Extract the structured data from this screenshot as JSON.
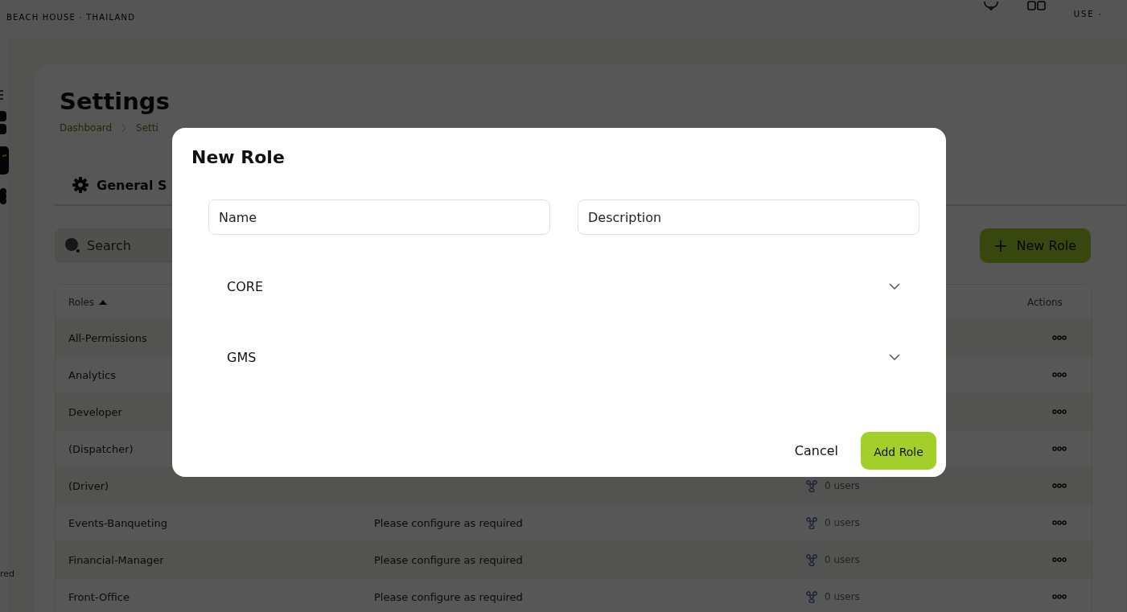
{
  "header": {
    "brand_tagline": "BEACH HOUSE · THAILAND",
    "user_label": "USE ·"
  },
  "sidebar": {
    "footer_text": "red"
  },
  "page": {
    "title": "Settings",
    "breadcrumb": [
      "Dashboard",
      "Setti"
    ],
    "tabs": [
      {
        "label": "General S",
        "selected": true
      }
    ],
    "search": {
      "placeholder": "Search"
    },
    "new_button": "New Role",
    "table": {
      "columns": [
        {
          "label": "Roles",
          "sort_ascending": true
        },
        {
          "label": "Actions"
        }
      ],
      "rows": [
        {
          "name": "All-Permissions"
        },
        {
          "name": "Analytics"
        },
        {
          "name": "Developer"
        },
        {
          "name": "(Dispatcher)"
        },
        {
          "name": "(Driver)",
          "users": "0 users"
        },
        {
          "name": "Events-Banqueting",
          "description": "Please configure as required",
          "users": "0 users"
        },
        {
          "name": "Financial-Manager",
          "description": "Please configure as required",
          "users": "0 users"
        },
        {
          "name": "Front-Office",
          "description": "Please configure as required",
          "users": "0 users"
        }
      ]
    }
  },
  "modal": {
    "title": "New Role",
    "fields": [
      {
        "placeholder": "Name"
      },
      {
        "placeholder": "Description"
      }
    ],
    "sections": [
      {
        "label": "CORE",
        "expanded": false
      },
      {
        "label": "GMS",
        "expanded": false
      }
    ],
    "buttons": {
      "cancel": "Cancel",
      "confirm": "Add Role"
    }
  }
}
